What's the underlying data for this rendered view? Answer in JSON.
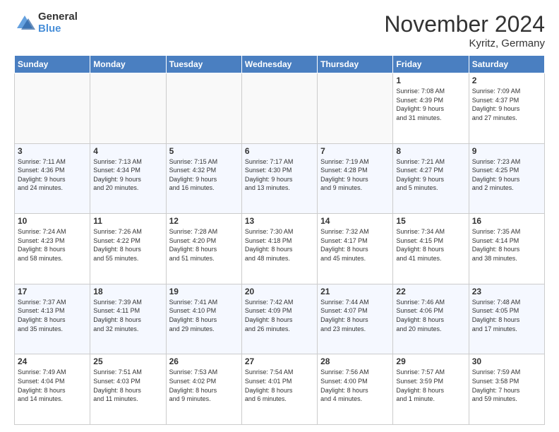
{
  "logo": {
    "general": "General",
    "blue": "Blue"
  },
  "header": {
    "month": "November 2024",
    "location": "Kyritz, Germany"
  },
  "weekdays": [
    "Sunday",
    "Monday",
    "Tuesday",
    "Wednesday",
    "Thursday",
    "Friday",
    "Saturday"
  ],
  "weeks": [
    [
      {
        "day": "",
        "info": ""
      },
      {
        "day": "",
        "info": ""
      },
      {
        "day": "",
        "info": ""
      },
      {
        "day": "",
        "info": ""
      },
      {
        "day": "",
        "info": ""
      },
      {
        "day": "1",
        "info": "Sunrise: 7:08 AM\nSunset: 4:39 PM\nDaylight: 9 hours\nand 31 minutes."
      },
      {
        "day": "2",
        "info": "Sunrise: 7:09 AM\nSunset: 4:37 PM\nDaylight: 9 hours\nand 27 minutes."
      }
    ],
    [
      {
        "day": "3",
        "info": "Sunrise: 7:11 AM\nSunset: 4:36 PM\nDaylight: 9 hours\nand 24 minutes."
      },
      {
        "day": "4",
        "info": "Sunrise: 7:13 AM\nSunset: 4:34 PM\nDaylight: 9 hours\nand 20 minutes."
      },
      {
        "day": "5",
        "info": "Sunrise: 7:15 AM\nSunset: 4:32 PM\nDaylight: 9 hours\nand 16 minutes."
      },
      {
        "day": "6",
        "info": "Sunrise: 7:17 AM\nSunset: 4:30 PM\nDaylight: 9 hours\nand 13 minutes."
      },
      {
        "day": "7",
        "info": "Sunrise: 7:19 AM\nSunset: 4:28 PM\nDaylight: 9 hours\nand 9 minutes."
      },
      {
        "day": "8",
        "info": "Sunrise: 7:21 AM\nSunset: 4:27 PM\nDaylight: 9 hours\nand 5 minutes."
      },
      {
        "day": "9",
        "info": "Sunrise: 7:23 AM\nSunset: 4:25 PM\nDaylight: 9 hours\nand 2 minutes."
      }
    ],
    [
      {
        "day": "10",
        "info": "Sunrise: 7:24 AM\nSunset: 4:23 PM\nDaylight: 8 hours\nand 58 minutes."
      },
      {
        "day": "11",
        "info": "Sunrise: 7:26 AM\nSunset: 4:22 PM\nDaylight: 8 hours\nand 55 minutes."
      },
      {
        "day": "12",
        "info": "Sunrise: 7:28 AM\nSunset: 4:20 PM\nDaylight: 8 hours\nand 51 minutes."
      },
      {
        "day": "13",
        "info": "Sunrise: 7:30 AM\nSunset: 4:18 PM\nDaylight: 8 hours\nand 48 minutes."
      },
      {
        "day": "14",
        "info": "Sunrise: 7:32 AM\nSunset: 4:17 PM\nDaylight: 8 hours\nand 45 minutes."
      },
      {
        "day": "15",
        "info": "Sunrise: 7:34 AM\nSunset: 4:15 PM\nDaylight: 8 hours\nand 41 minutes."
      },
      {
        "day": "16",
        "info": "Sunrise: 7:35 AM\nSunset: 4:14 PM\nDaylight: 8 hours\nand 38 minutes."
      }
    ],
    [
      {
        "day": "17",
        "info": "Sunrise: 7:37 AM\nSunset: 4:13 PM\nDaylight: 8 hours\nand 35 minutes."
      },
      {
        "day": "18",
        "info": "Sunrise: 7:39 AM\nSunset: 4:11 PM\nDaylight: 8 hours\nand 32 minutes."
      },
      {
        "day": "19",
        "info": "Sunrise: 7:41 AM\nSunset: 4:10 PM\nDaylight: 8 hours\nand 29 minutes."
      },
      {
        "day": "20",
        "info": "Sunrise: 7:42 AM\nSunset: 4:09 PM\nDaylight: 8 hours\nand 26 minutes."
      },
      {
        "day": "21",
        "info": "Sunrise: 7:44 AM\nSunset: 4:07 PM\nDaylight: 8 hours\nand 23 minutes."
      },
      {
        "day": "22",
        "info": "Sunrise: 7:46 AM\nSunset: 4:06 PM\nDaylight: 8 hours\nand 20 minutes."
      },
      {
        "day": "23",
        "info": "Sunrise: 7:48 AM\nSunset: 4:05 PM\nDaylight: 8 hours\nand 17 minutes."
      }
    ],
    [
      {
        "day": "24",
        "info": "Sunrise: 7:49 AM\nSunset: 4:04 PM\nDaylight: 8 hours\nand 14 minutes."
      },
      {
        "day": "25",
        "info": "Sunrise: 7:51 AM\nSunset: 4:03 PM\nDaylight: 8 hours\nand 11 minutes."
      },
      {
        "day": "26",
        "info": "Sunrise: 7:53 AM\nSunset: 4:02 PM\nDaylight: 8 hours\nand 9 minutes."
      },
      {
        "day": "27",
        "info": "Sunrise: 7:54 AM\nSunset: 4:01 PM\nDaylight: 8 hours\nand 6 minutes."
      },
      {
        "day": "28",
        "info": "Sunrise: 7:56 AM\nSunset: 4:00 PM\nDaylight: 8 hours\nand 4 minutes."
      },
      {
        "day": "29",
        "info": "Sunrise: 7:57 AM\nSunset: 3:59 PM\nDaylight: 8 hours\nand 1 minute."
      },
      {
        "day": "30",
        "info": "Sunrise: 7:59 AM\nSunset: 3:58 PM\nDaylight: 7 hours\nand 59 minutes."
      }
    ]
  ]
}
